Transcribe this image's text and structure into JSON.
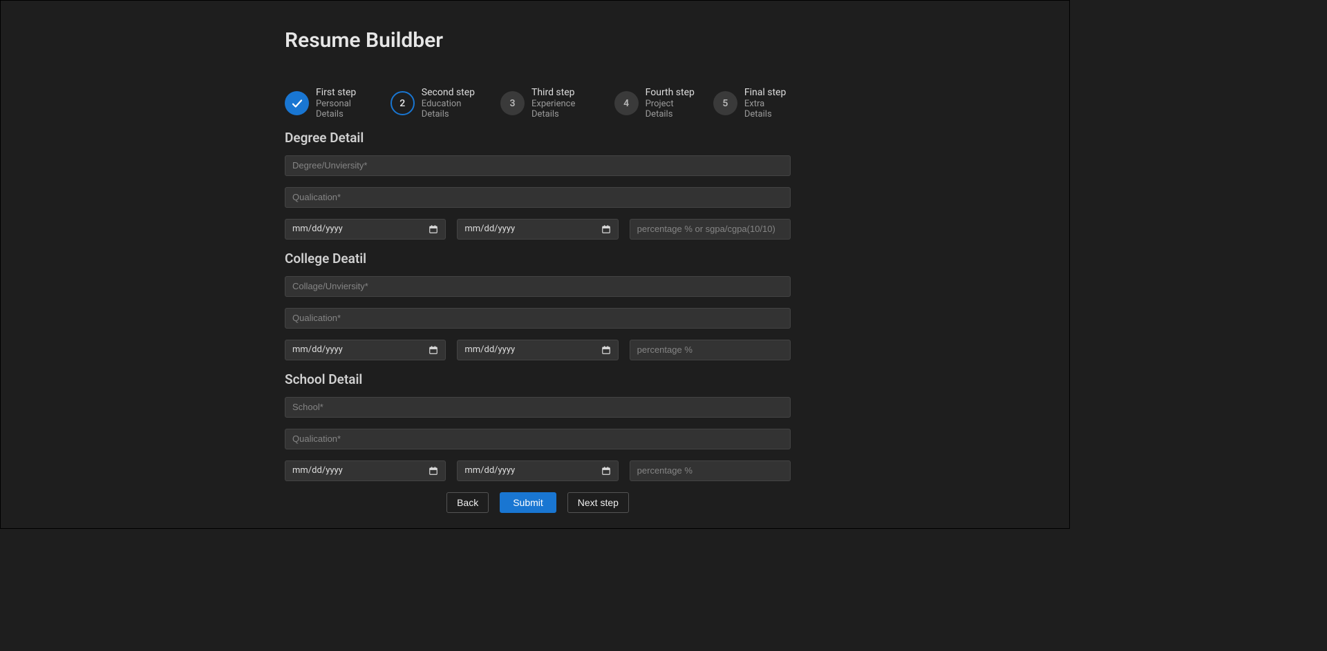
{
  "header": {
    "title": "Resume Buildber"
  },
  "stepper": {
    "steps": [
      {
        "title": "First step",
        "sub": "Personal Details"
      },
      {
        "title": "Second step",
        "sub": "Education Details",
        "num": "2"
      },
      {
        "title": "Third step",
        "sub": "Experience Details",
        "num": "3"
      },
      {
        "title": "Fourth step",
        "sub": "Project Details",
        "num": "4"
      },
      {
        "title": "Final step",
        "sub": "Extra Details",
        "num": "5"
      }
    ]
  },
  "sections": {
    "degree": {
      "title": "Degree Detail",
      "inst_ph": "Degree/Unviersity*",
      "qual_ph": "Qualication*",
      "date_ph": "mm/dd/yyyy",
      "pct_ph": "percentage % or sgpa/cgpa(10/10)"
    },
    "college": {
      "title": "College Deatil",
      "inst_ph": "Collage/Unviersity*",
      "qual_ph": "Qualication*",
      "date_ph": "mm/dd/yyyy",
      "pct_ph": "percentage %"
    },
    "school": {
      "title": "School Detail",
      "inst_ph": "School*",
      "qual_ph": "Qualication*",
      "date_ph": "mm/dd/yyyy",
      "pct_ph": "percentage %"
    }
  },
  "buttons": {
    "back": "Back",
    "submit": "Submit",
    "next": "Next step"
  }
}
